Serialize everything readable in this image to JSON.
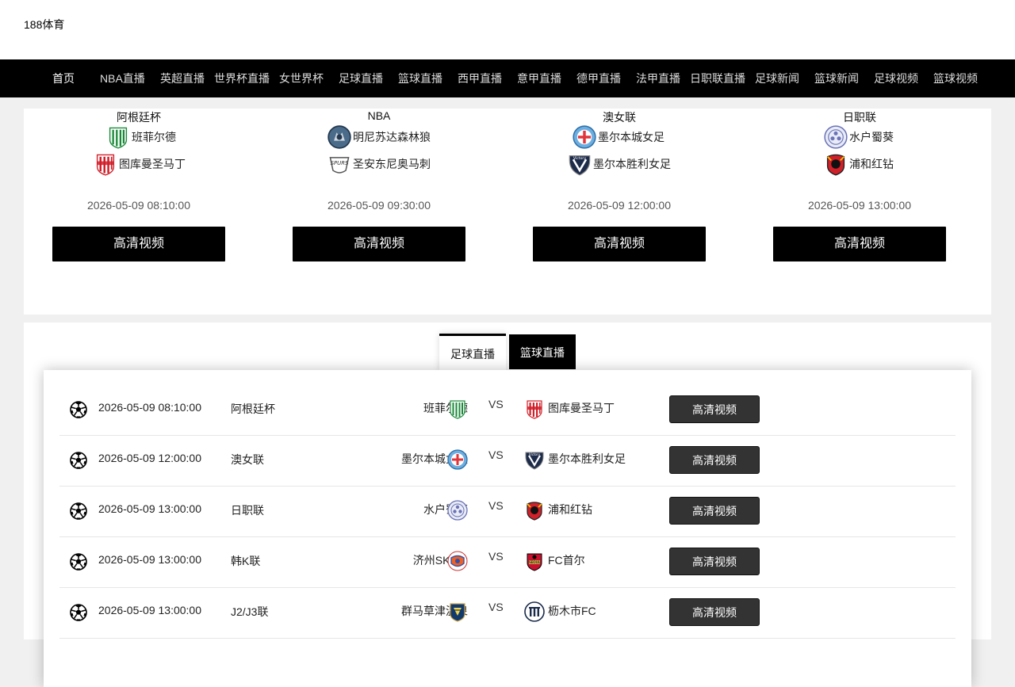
{
  "site": {
    "logo": "188体育"
  },
  "nav": [
    {
      "label": "首页"
    },
    {
      "label": "NBA直播"
    },
    {
      "label": "英超直播"
    },
    {
      "label": "世界杯直播"
    },
    {
      "label": "女世界杯"
    },
    {
      "label": "足球直播"
    },
    {
      "label": "篮球直播"
    },
    {
      "label": "西甲直播"
    },
    {
      "label": "意甲直播"
    },
    {
      "label": "德甲直播"
    },
    {
      "label": "法甲直播"
    },
    {
      "label": "日职联直播"
    },
    {
      "label": "足球新闻"
    },
    {
      "label": "篮球新闻"
    },
    {
      "label": "足球视频"
    },
    {
      "label": "篮球视频"
    }
  ],
  "featured": [
    {
      "league": "阿根廷杯",
      "home": "班菲尔德",
      "away": "图库曼圣马丁",
      "time": "2026-05-09 08:10:00",
      "button": "高清视频"
    },
    {
      "league": "NBA",
      "home": "明尼苏达森林狼",
      "away": "圣安东尼奥马刺",
      "time": "2026-05-09 09:30:00",
      "button": "高清视频"
    },
    {
      "league": "澳女联",
      "home": "墨尔本城女足",
      "away": "墨尔本胜利女足",
      "time": "2026-05-09 12:00:00",
      "button": "高清视频"
    },
    {
      "league": "日职联",
      "home": "水户蜀葵",
      "away": "浦和红钻",
      "time": "2026-05-09 13:00:00",
      "button": "高清视频"
    }
  ],
  "tabs": {
    "football": "足球直播",
    "basketball": "篮球直播"
  },
  "matches": [
    {
      "time": "2026-05-09 08:10:00",
      "league": "阿根廷杯",
      "home": "班菲尔德",
      "vs": "VS",
      "away": "图库曼圣马丁",
      "button": "高清视频"
    },
    {
      "time": "2026-05-09 12:00:00",
      "league": "澳女联",
      "home": "墨尔本城女足",
      "vs": "VS",
      "away": "墨尔本胜利女足",
      "button": "高清视频"
    },
    {
      "time": "2026-05-09 13:00:00",
      "league": "日职联",
      "home": "水户蜀葵",
      "vs": "VS",
      "away": "浦和红钻",
      "button": "高清视频"
    },
    {
      "time": "2026-05-09 13:00:00",
      "league": "韩K联",
      "home": "济州SK FC",
      "vs": "VS",
      "away": "FC首尔",
      "button": "高清视频"
    },
    {
      "time": "2026-05-09 13:00:00",
      "league": "J2/J3联",
      "home": "群马草津温泉",
      "vs": "VS",
      "away": "枥木市FC",
      "button": "高清视频"
    }
  ],
  "colors": {
    "nav_bg": "#000000",
    "button_dark": "#333333",
    "page_bg": "#f0f0f0"
  }
}
